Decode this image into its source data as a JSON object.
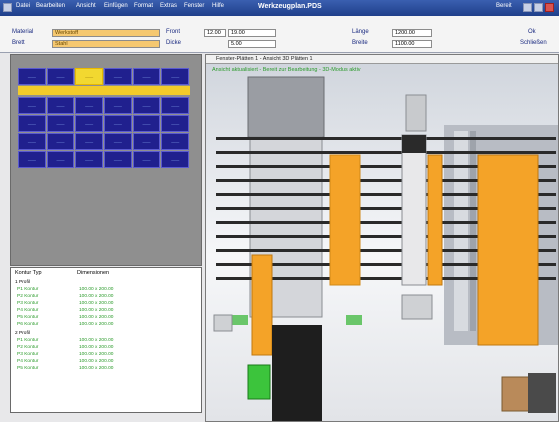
{
  "titlebar": {
    "title": "Werkzeugplan.PDS",
    "menu": [
      "Datei",
      "Bearbeiten",
      "Ansicht",
      "Einfügen",
      "Format",
      "Extras",
      "Fenster",
      "Hilfe"
    ],
    "ready": "Bereit"
  },
  "params": {
    "material_label": "Material",
    "material_value": "Werkstoff",
    "board_label": "Brett",
    "board_value": "Stahl",
    "front_label": "Front",
    "front_value": "19.00",
    "thickness_label": "Dicke",
    "thickness_value": "5.00",
    "depth_value": "12.00",
    "length_label": "Länge",
    "length_value": "1200.00",
    "width_label": "Breite",
    "width_value": "1100.00",
    "fit_label": "Ok",
    "close_label": "Schließen"
  },
  "matrix": {
    "cell_text": "——",
    "cols": 6,
    "rows": 5,
    "selected": {
      "row": 0,
      "col": 2
    }
  },
  "table": {
    "col1": "Kontur Typ",
    "col2": "Dimensionen",
    "groups": [
      {
        "title": "1 Profil",
        "rows": [
          {
            "a": "P1 Kontur",
            "b": "100.00 x 200.00"
          },
          {
            "a": "P2 Kontur",
            "b": "100.00 x 200.00"
          },
          {
            "a": "P3 Kontur",
            "b": "100.00 x 200.00"
          },
          {
            "a": "P4 Kontur",
            "b": "100.00 x 200.00"
          },
          {
            "a": "P5 Kontur",
            "b": "100.00 x 200.00"
          },
          {
            "a": "P6 Kontur",
            "b": "100.00 x 200.00"
          }
        ]
      },
      {
        "title": "2 Profil",
        "rows": [
          {
            "a": "P1 Kontur",
            "b": "100.00 x 200.00"
          },
          {
            "a": "P2 Kontur",
            "b": "100.00 x 200.00"
          },
          {
            "a": "P3 Kontur",
            "b": "100.00 x 200.00"
          },
          {
            "a": "P4 Kontur",
            "b": "100.00 x 200.00"
          },
          {
            "a": "P5 Kontur",
            "b": "100.00 x 200.00"
          }
        ]
      }
    ]
  },
  "view": {
    "title": "Fenster-Plätten 1 - Ansicht 3D Plätten 1",
    "status": "Ansicht aktualisiert - Bereit zur Bearbeitung - 3D-Modus aktiv"
  },
  "colors": {
    "accent_blue": "#1f3f8a",
    "cell_blue": "#20208e",
    "rail_yellow": "#f2cb2a",
    "part_orange": "#f4a328",
    "terminal_green": "#3cc43c"
  }
}
